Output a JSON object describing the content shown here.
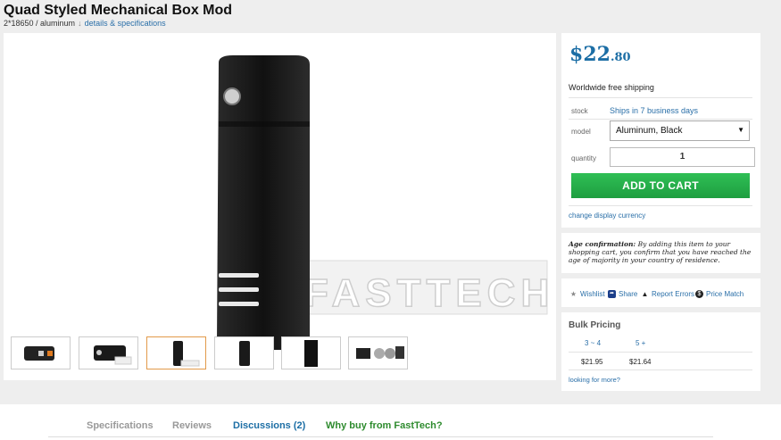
{
  "product": {
    "title": "Quad Styled Mechanical Box Mod",
    "spec_summary": "2*18650 / aluminum",
    "details_link": "details & specifications"
  },
  "price": {
    "currency": "$",
    "dollars": "22",
    "cents": ".80"
  },
  "shipping": "Worldwide free shipping",
  "stock": {
    "label": "stock",
    "value": "Ships in 7 business days"
  },
  "model": {
    "label": "model",
    "selected": "Aluminum, Black"
  },
  "quantity": {
    "label": "quantity",
    "value": "1"
  },
  "add_to_cart": "ADD TO CART",
  "change_currency": "change display currency",
  "age": {
    "heading": "Age confirmation:",
    "text": "By adding this item to your shopping cart, you confirm that you have reached the age of majority in your country of residence."
  },
  "actions": {
    "wishlist": "Wishlist",
    "share": "Share",
    "report": "Report Errors",
    "price_match": "Price Match"
  },
  "bulk": {
    "title": "Bulk Pricing",
    "tiers": [
      {
        "qty": "3 ~ 4",
        "price": "$21.95"
      },
      {
        "qty": "5 +",
        "price": "$21.64"
      }
    ],
    "looking": "looking for more?"
  },
  "tabs": [
    "Specifications",
    "Reviews",
    "Discussions (2)",
    "Why buy from FastTech?"
  ],
  "watermark": "FASTTECH",
  "colors": {
    "price": "#1c6ea5",
    "cart": "#2fbf55",
    "link": "#2a6fa8",
    "active_tab": "#1c6ea5",
    "why_tab": "#2e8b2e"
  }
}
